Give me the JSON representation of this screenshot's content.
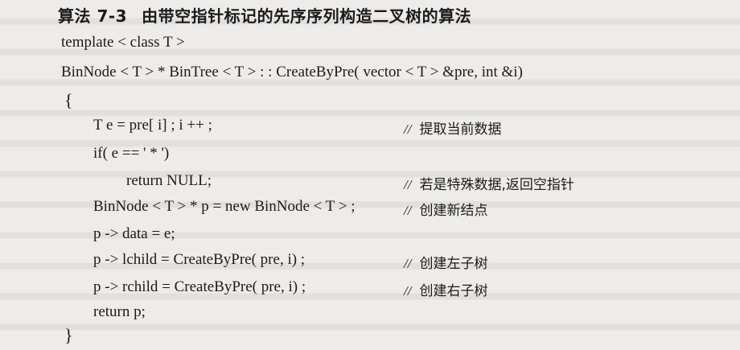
{
  "algorithm": {
    "number": "算法 7-3",
    "title": "由带空指针标记的先序序列构造二叉树的算法"
  },
  "code": {
    "template": "template  < class  T >",
    "signature": "BinNode < T >  * BinTree < T > : : CreateByPre( vector < T > &pre, int &i)",
    "open_brace": "{",
    "lines": [
      {
        "code": "T e = pre[ i] ;  i ++ ;",
        "comment": "提取当前数据"
      },
      {
        "code": "if( e == ' * ')",
        "comment": ""
      },
      {
        "code": "return NULL;",
        "comment": "若是特殊数据,返回空指针"
      },
      {
        "code": "BinNode < T > * p = new BinNode < T > ;",
        "comment": "创建新结点"
      },
      {
        "code": "p -> data = e;",
        "comment": ""
      },
      {
        "code": "p -> lchild = CreateByPre( pre, i) ;",
        "comment": "创建左子树"
      },
      {
        "code": "p -> rchild = CreateByPre( pre, i) ;",
        "comment": "创建右子树"
      },
      {
        "code": "return p;",
        "comment": ""
      }
    ],
    "close_brace": "}",
    "comment_marker": "//"
  }
}
